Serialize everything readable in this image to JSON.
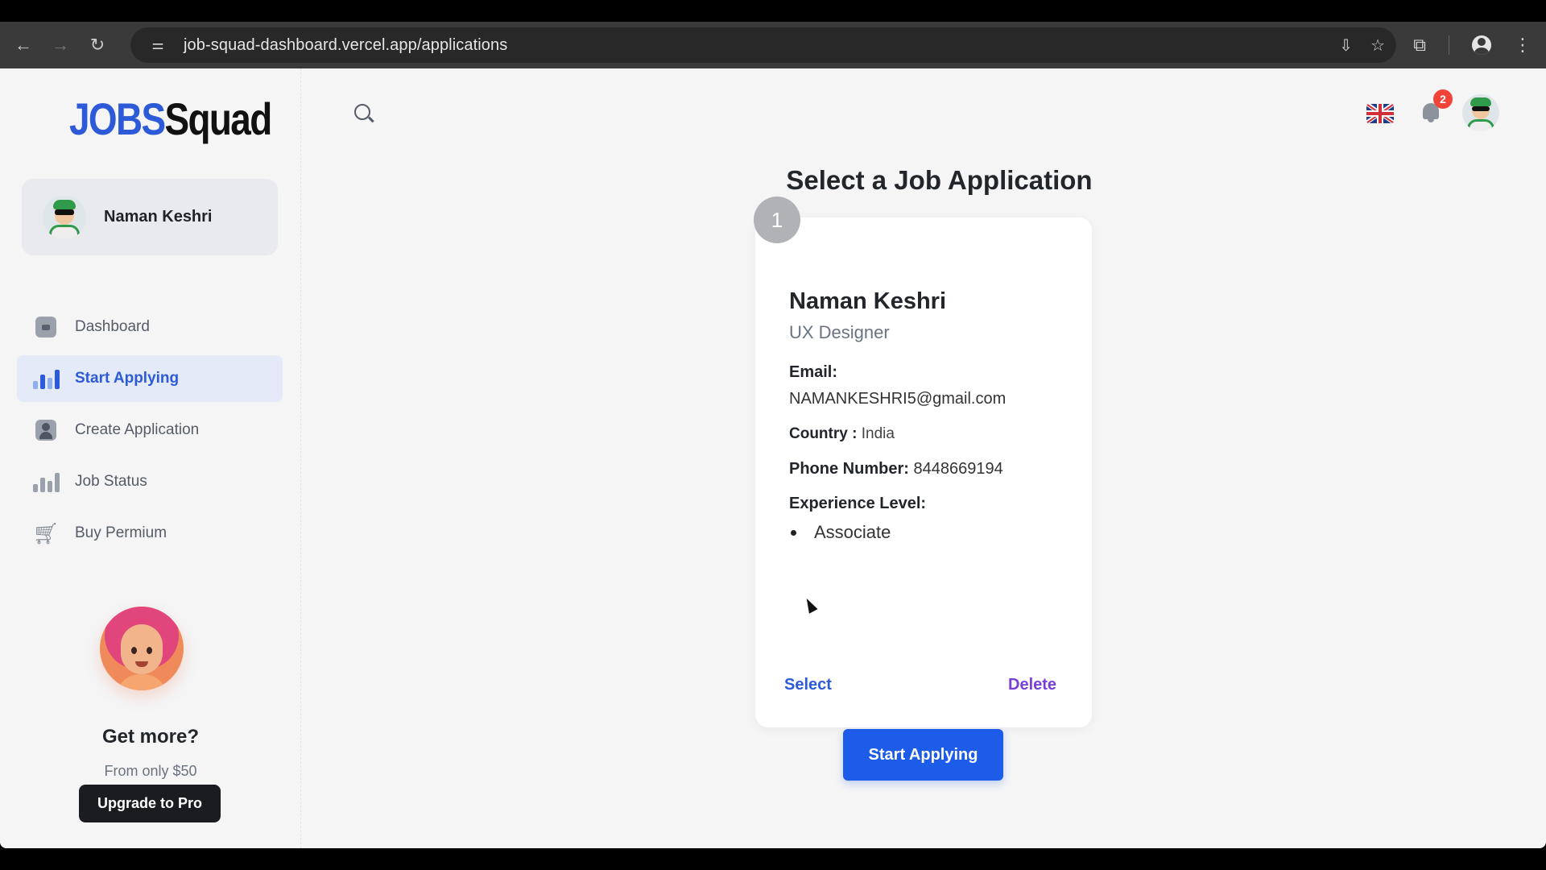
{
  "browser": {
    "url": "job-squad-dashboard.vercel.app/applications",
    "back_icon": "←",
    "forward_icon": "→",
    "reload_icon": "↻",
    "tune_icon": "⚌",
    "install_icon": "⇩",
    "star_icon": "☆",
    "extensions_icon": "⧉",
    "menu_icon": "⋮"
  },
  "sidebar": {
    "logo_jobs": "JOBS",
    "logo_squad": "quad",
    "logo_s": "S",
    "user_name": "Naman Keshri",
    "items": [
      {
        "label": "Dashboard",
        "icon": "document-icon",
        "active": false
      },
      {
        "label": "Start Applying",
        "icon": "chart-icon",
        "active": true
      },
      {
        "label": "Create Application",
        "icon": "person-icon",
        "active": false
      },
      {
        "label": "Job Status",
        "icon": "chart-icon",
        "active": false
      },
      {
        "label": "Buy Permium",
        "icon": "cart-icon",
        "active": false
      }
    ],
    "promo": {
      "title": "Get more?",
      "subtitle": "From only $50",
      "button": "Upgrade to Pro"
    }
  },
  "header": {
    "notification_count": "2"
  },
  "main": {
    "title": "Select a Job Application",
    "card": {
      "index": "1",
      "name": "Naman Keshri",
      "role": "UX Designer",
      "email_label": "Email:",
      "email": "NAMANKESHRI5@gmail.com",
      "country_label": "Country :",
      "country": "India",
      "phone_label": "Phone Number:",
      "phone": "8448669194",
      "experience_label": "Experience Level:",
      "experience": "Associate",
      "select_label": "Select",
      "delete_label": "Delete"
    },
    "start_button": "Start Applying"
  },
  "colors": {
    "accent": "#2d5bd8",
    "primary_button": "#1d5ce8",
    "delete": "#7a3fd6",
    "badge": "#f04438"
  }
}
